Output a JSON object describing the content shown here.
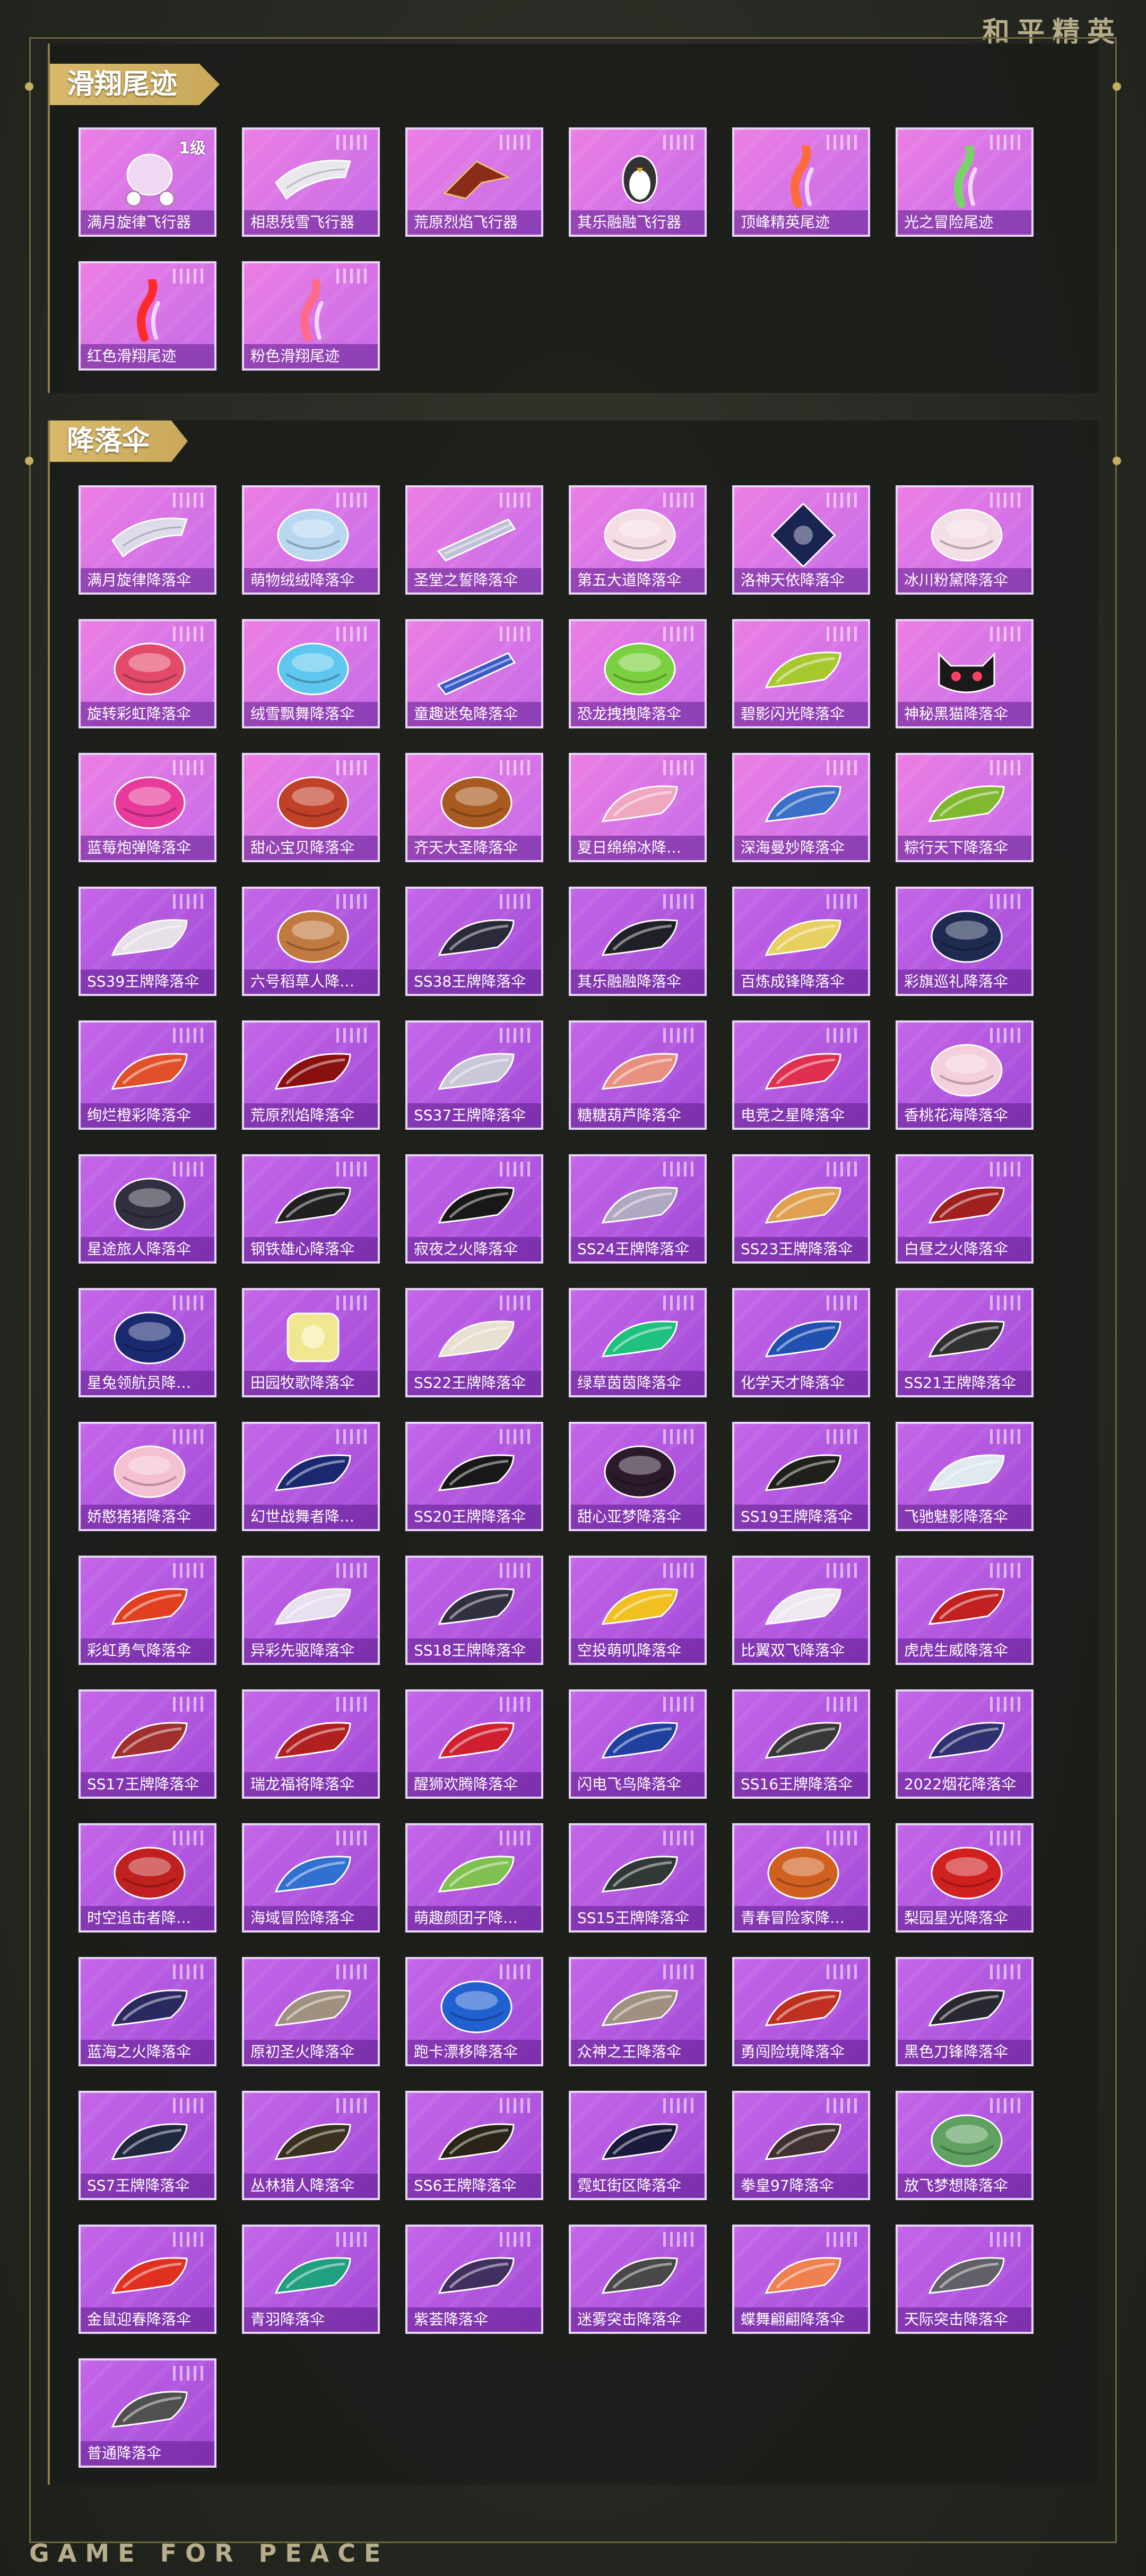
{
  "brand": {
    "top": "和平精英",
    "bottom": "GAME FOR PEACE"
  },
  "sections": [
    {
      "title": "滑翔尾迹",
      "items": [
        {
          "label": "满月旋律飞行器",
          "badge": "1级",
          "color": "#f0d8f2",
          "shape": "carriage"
        },
        {
          "label": "相思残雪飞行器",
          "badge": "",
          "color": "#e8e8ee",
          "shape": "wing"
        },
        {
          "label": "荒原烈焰飞行器",
          "badge": "",
          "color": "#8b2b1a",
          "shape": "glider"
        },
        {
          "label": "其乐融融飞行器",
          "badge": "",
          "color": "#333333",
          "shape": "penguin"
        },
        {
          "label": "顶峰精英尾迹",
          "badge": "",
          "color": "#ff6a3c",
          "shape": "trail"
        },
        {
          "label": "光之冒险尾迹",
          "badge": "",
          "color": "#7ad36a",
          "shape": "trail"
        },
        {
          "label": "红色滑翔尾迹",
          "badge": "",
          "color": "#ff2a2a",
          "shape": "trail"
        },
        {
          "label": "粉色滑翔尾迹",
          "badge": "",
          "color": "#ff6a8c",
          "shape": "trail"
        }
      ]
    },
    {
      "title": "降落伞",
      "items": [
        {
          "label": "满月旋律降落伞",
          "color": "#dcdcea",
          "shape": "wing"
        },
        {
          "label": "萌物绒绒降落伞",
          "color": "#b8d8f0",
          "shape": "round"
        },
        {
          "label": "圣堂之誓降落伞",
          "color": "#c0c0d8",
          "shape": "flat"
        },
        {
          "label": "第五大道降落伞",
          "color": "#f5dde4",
          "shape": "round"
        },
        {
          "label": "洛神天依降落伞",
          "color": "#1a2450",
          "shape": "diamond"
        },
        {
          "label": "冰川粉黛降落伞",
          "color": "#f3dfe6",
          "shape": "round"
        },
        {
          "label": "旋转彩虹降落伞",
          "color": "#e24a6a",
          "shape": "round"
        },
        {
          "label": "绒雪飘舞降落伞",
          "color": "#5ec6ef",
          "shape": "round"
        },
        {
          "label": "童趣迷兔降落伞",
          "color": "#3a5ac8",
          "shape": "flat"
        },
        {
          "label": "恐龙拽拽降落伞",
          "color": "#7ad040",
          "shape": "round"
        },
        {
          "label": "碧影闪光降落伞",
          "color": "#a8c830",
          "shape": "canopy"
        },
        {
          "label": "神秘黑猫降落伞",
          "color": "#1a1a1a",
          "shape": "cat"
        },
        {
          "label": "蓝莓炮弹降落伞",
          "color": "#e73a9a",
          "shape": "round"
        },
        {
          "label": "甜心宝贝降落伞",
          "color": "#c04028",
          "shape": "round"
        },
        {
          "label": "齐天大圣降落伞",
          "color": "#a85a20",
          "shape": "round"
        },
        {
          "label": "夏日绵绵冰降…",
          "color": "#f0a8c0",
          "shape": "canopy"
        },
        {
          "label": "深海曼妙降落伞",
          "color": "#3a70c8",
          "shape": "canopy"
        },
        {
          "label": "粽行天下降落伞",
          "color": "#80b830",
          "shape": "canopy"
        },
        {
          "label": "SS39王牌降落伞",
          "color": "#e8e0e8",
          "shape": "canopy"
        },
        {
          "label": "六号稻草人降…",
          "color": "#c07a40",
          "shape": "round"
        },
        {
          "label": "SS38王牌降落伞",
          "color": "#2a2a3a",
          "shape": "canopy"
        },
        {
          "label": "其乐融融降落伞",
          "color": "#202028",
          "shape": "canopy"
        },
        {
          "label": "百炼成锋降落伞",
          "color": "#e8d060",
          "shape": "canopy"
        },
        {
          "label": "彩旗巡礼降落伞",
          "color": "#1e2a50",
          "shape": "round"
        },
        {
          "label": "绚烂橙彩降落伞",
          "color": "#e0502a",
          "shape": "canopy"
        },
        {
          "label": "荒原烈焰降落伞",
          "color": "#8a1010",
          "shape": "canopy"
        },
        {
          "label": "SS37王牌降落伞",
          "color": "#c8c8d8",
          "shape": "canopy"
        },
        {
          "label": "糖糖葫芦降落伞",
          "color": "#e89080",
          "shape": "canopy"
        },
        {
          "label": "电竞之星降落伞",
          "color": "#e03050",
          "shape": "canopy"
        },
        {
          "label": "香桃花海降落伞",
          "color": "#f5d0dc",
          "shape": "round"
        },
        {
          "label": "星途旅人降落伞",
          "color": "#303040",
          "shape": "round"
        },
        {
          "label": "钢铁雄心降落伞",
          "color": "#202020",
          "shape": "canopy"
        },
        {
          "label": "寂夜之火降落伞",
          "color": "#181818",
          "shape": "canopy"
        },
        {
          "label": "SS24王牌降落伞",
          "color": "#b0a8c0",
          "shape": "canopy"
        },
        {
          "label": "SS23王牌降落伞",
          "color": "#e0a050",
          "shape": "canopy"
        },
        {
          "label": "白昼之火降落伞",
          "color": "#a02020",
          "shape": "canopy"
        },
        {
          "label": "星兔领航员降…",
          "color": "#1a2a70",
          "shape": "round"
        },
        {
          "label": "田园牧歌降落伞",
          "color": "#f0e890",
          "shape": "square"
        },
        {
          "label": "SS22王牌降落伞",
          "color": "#e8e0d0",
          "shape": "canopy"
        },
        {
          "label": "绿草茵茵降落伞",
          "color": "#20c080",
          "shape": "canopy"
        },
        {
          "label": "化学天才降落伞",
          "color": "#2050b0",
          "shape": "canopy"
        },
        {
          "label": "SS21王牌降落伞",
          "color": "#303030",
          "shape": "canopy"
        },
        {
          "label": "娇憨猪猪降落伞",
          "color": "#f5c0d0",
          "shape": "round"
        },
        {
          "label": "幻世战舞者降…",
          "color": "#1a2870",
          "shape": "canopy"
        },
        {
          "label": "SS20王牌降落伞",
          "color": "#181818",
          "shape": "canopy"
        },
        {
          "label": "甜心亚梦降落伞",
          "color": "#2a1a2a",
          "shape": "round"
        },
        {
          "label": "SS19王牌降落伞",
          "color": "#20201a",
          "shape": "canopy"
        },
        {
          "label": "飞驰魅影降落伞",
          "color": "#e0e8f0",
          "shape": "canopy"
        },
        {
          "label": "彩虹勇气降落伞",
          "color": "#e04020",
          "shape": "canopy"
        },
        {
          "label": "异彩先驱降落伞",
          "color": "#e8e0f0",
          "shape": "canopy"
        },
        {
          "label": "SS18王牌降落伞",
          "color": "#303040",
          "shape": "canopy"
        },
        {
          "label": "空投萌叽降落伞",
          "color": "#f0c020",
          "shape": "canopy"
        },
        {
          "label": "比翼双飞降落伞",
          "color": "#f0e8f0",
          "shape": "canopy"
        },
        {
          "label": "虎虎生威降落伞",
          "color": "#c02020",
          "shape": "canopy"
        },
        {
          "label": "SS17王牌降落伞",
          "color": "#a03030",
          "shape": "canopy"
        },
        {
          "label": "瑞龙福将降落伞",
          "color": "#b02020",
          "shape": "canopy"
        },
        {
          "label": "醒狮欢腾降落伞",
          "color": "#d02030",
          "shape": "canopy"
        },
        {
          "label": "闪电飞鸟降落伞",
          "color": "#2040a0",
          "shape": "canopy"
        },
        {
          "label": "SS16王牌降落伞",
          "color": "#383838",
          "shape": "canopy"
        },
        {
          "label": "2022烟花降落伞",
          "color": "#303070",
          "shape": "canopy"
        },
        {
          "label": "时空追击者降…",
          "color": "#c02020",
          "shape": "round"
        },
        {
          "label": "海域冒险降落伞",
          "color": "#3070d0",
          "shape": "canopy"
        },
        {
          "label": "萌趣颜团子降…",
          "color": "#80c050",
          "shape": "canopy"
        },
        {
          "label": "SS15王牌降落伞",
          "color": "#303838",
          "shape": "canopy"
        },
        {
          "label": "青春冒险家降…",
          "color": "#d06020",
          "shape": "round"
        },
        {
          "label": "梨园星光降落伞",
          "color": "#d02020",
          "shape": "round"
        },
        {
          "label": "蓝海之火降落伞",
          "color": "#2a2a60",
          "shape": "canopy"
        },
        {
          "label": "原初圣火降落伞",
          "color": "#a09080",
          "shape": "canopy"
        },
        {
          "label": "跑卡漂移降落伞",
          "color": "#2060d0",
          "shape": "round"
        },
        {
          "label": "众神之王降落伞",
          "color": "#a09080",
          "shape": "canopy"
        },
        {
          "label": "勇闯险境降落伞",
          "color": "#c03020",
          "shape": "canopy"
        },
        {
          "label": "黑色刀锋降落伞",
          "color": "#282830",
          "shape": "canopy"
        },
        {
          "label": "SS7王牌降落伞",
          "color": "#202840",
          "shape": "canopy"
        },
        {
          "label": "丛林猎人降落伞",
          "color": "#3a3020",
          "shape": "canopy"
        },
        {
          "label": "SS6王牌降落伞",
          "color": "#2a2418",
          "shape": "canopy"
        },
        {
          "label": "霓虹街区降落伞",
          "color": "#1a1a3a",
          "shape": "canopy"
        },
        {
          "label": "拳皇97降落伞",
          "color": "#403030",
          "shape": "canopy"
        },
        {
          "label": "放飞梦想降落伞",
          "color": "#60a060",
          "shape": "round"
        },
        {
          "label": "金鼠迎春降落伞",
          "color": "#e03020",
          "shape": "canopy"
        },
        {
          "label": "青羽降落伞",
          "color": "#20a080",
          "shape": "canopy"
        },
        {
          "label": "紫荟降落伞",
          "color": "#403060",
          "shape": "canopy"
        },
        {
          "label": "迷雾突击降落伞",
          "color": "#484848",
          "shape": "canopy"
        },
        {
          "label": "蝶舞翩翩降落伞",
          "color": "#f08050",
          "shape": "canopy"
        },
        {
          "label": "天际突击降落伞",
          "color": "#606068",
          "shape": "canopy"
        },
        {
          "label": "普通降落伞",
          "color": "#505050",
          "shape": "canopy"
        }
      ]
    }
  ]
}
